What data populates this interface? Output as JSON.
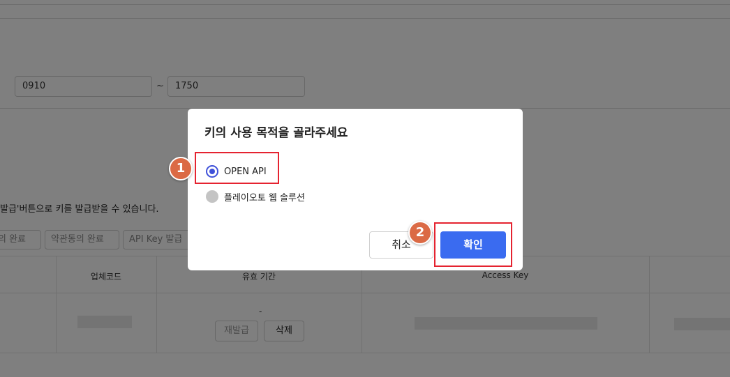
{
  "background": {
    "time_from": "0910",
    "time_separator": "~",
    "time_to": "1750",
    "hint": "발급'버튼으로 키를 발급받을 수 있습니다.",
    "steps": [
      "의 완료",
      "약관동의 완료",
      "API Key 발급"
    ],
    "table": {
      "headers": [
        "업체코드",
        "유효 기간",
        "Access Key"
      ],
      "row": {
        "validity": "-",
        "reissue_label": "재발급",
        "delete_label": "삭제"
      }
    }
  },
  "modal": {
    "title": "키의 사용 목적을 골라주세요",
    "options": [
      {
        "label": "OPEN API",
        "selected": true
      },
      {
        "label": "플레이오토 웹 솔루션",
        "selected": false
      }
    ],
    "cancel_label": "취소",
    "confirm_label": "확인"
  },
  "annotations": {
    "badge_1": "1",
    "badge_2": "2",
    "highlight_color": "#e52330",
    "badge_color": "#db6a45"
  },
  "colors": {
    "accent": "#3a6bf0",
    "radio": "#3f51d9"
  }
}
